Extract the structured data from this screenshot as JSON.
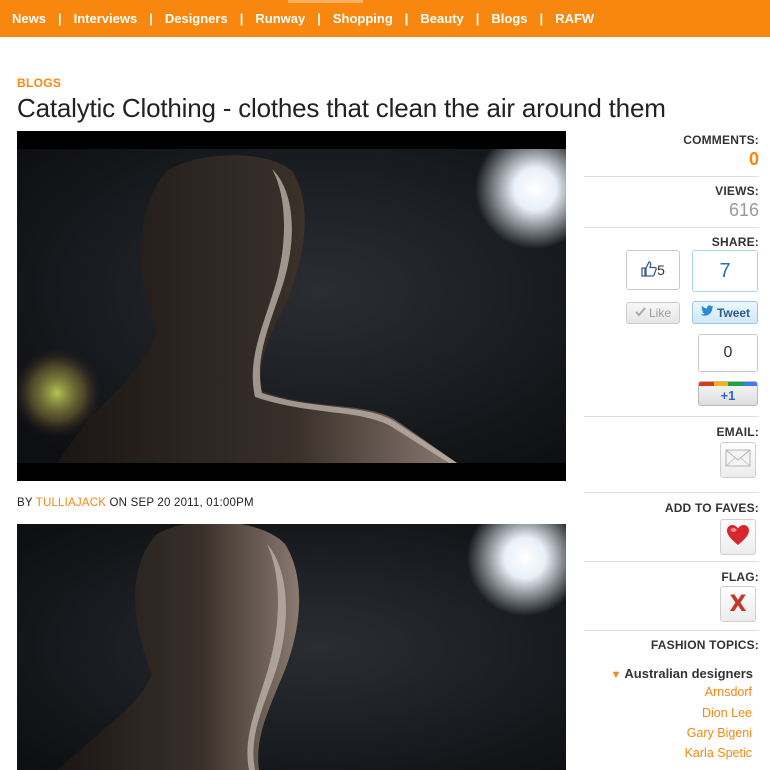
{
  "nav": {
    "items": [
      "News",
      "Interviews",
      "Designers",
      "Runway",
      "Shopping",
      "Beauty",
      "Blogs",
      "RAFW"
    ],
    "separator": "|"
  },
  "article": {
    "category": "BLOGS",
    "title": "Catalytic Clothing - clothes that clean the air around them",
    "byline": {
      "prefix": "BY",
      "author": "TULLIAJACK",
      "on": "ON",
      "date": "SEP 20 2011, 01:00PM"
    }
  },
  "sidebar": {
    "comments": {
      "label": "COMMENTS:",
      "count": "0"
    },
    "views": {
      "label": "VIEWS:",
      "count": "616"
    },
    "share": {
      "label": "SHARE:",
      "facebook": {
        "count": "5",
        "button": "Like"
      },
      "twitter": {
        "count": "7",
        "button": "Tweet"
      },
      "google": {
        "count": "0",
        "button": "+1"
      }
    },
    "email": {
      "label": "EMAIL:"
    },
    "faves": {
      "label": "ADD TO FAVES:"
    },
    "flag": {
      "label": "FLAG:",
      "glyph": "X"
    },
    "topics": {
      "label": "FASHION TOPICS:",
      "group": "Australian designers",
      "items": [
        "Arnsdorf",
        "Dion Lee",
        "Gary Bigeni",
        "Karla Spetic"
      ]
    }
  },
  "colors": {
    "accent": "#f7870f",
    "nav_bg": "#f7870f",
    "twitter": "#2a6fa8",
    "flag_red": "#c0392b"
  },
  "icons": [
    "thumbs-up-icon",
    "checkmark-icon",
    "twitter-bird-icon",
    "envelope-icon",
    "heart-icon",
    "close-x-icon",
    "triangle-down-icon"
  ]
}
